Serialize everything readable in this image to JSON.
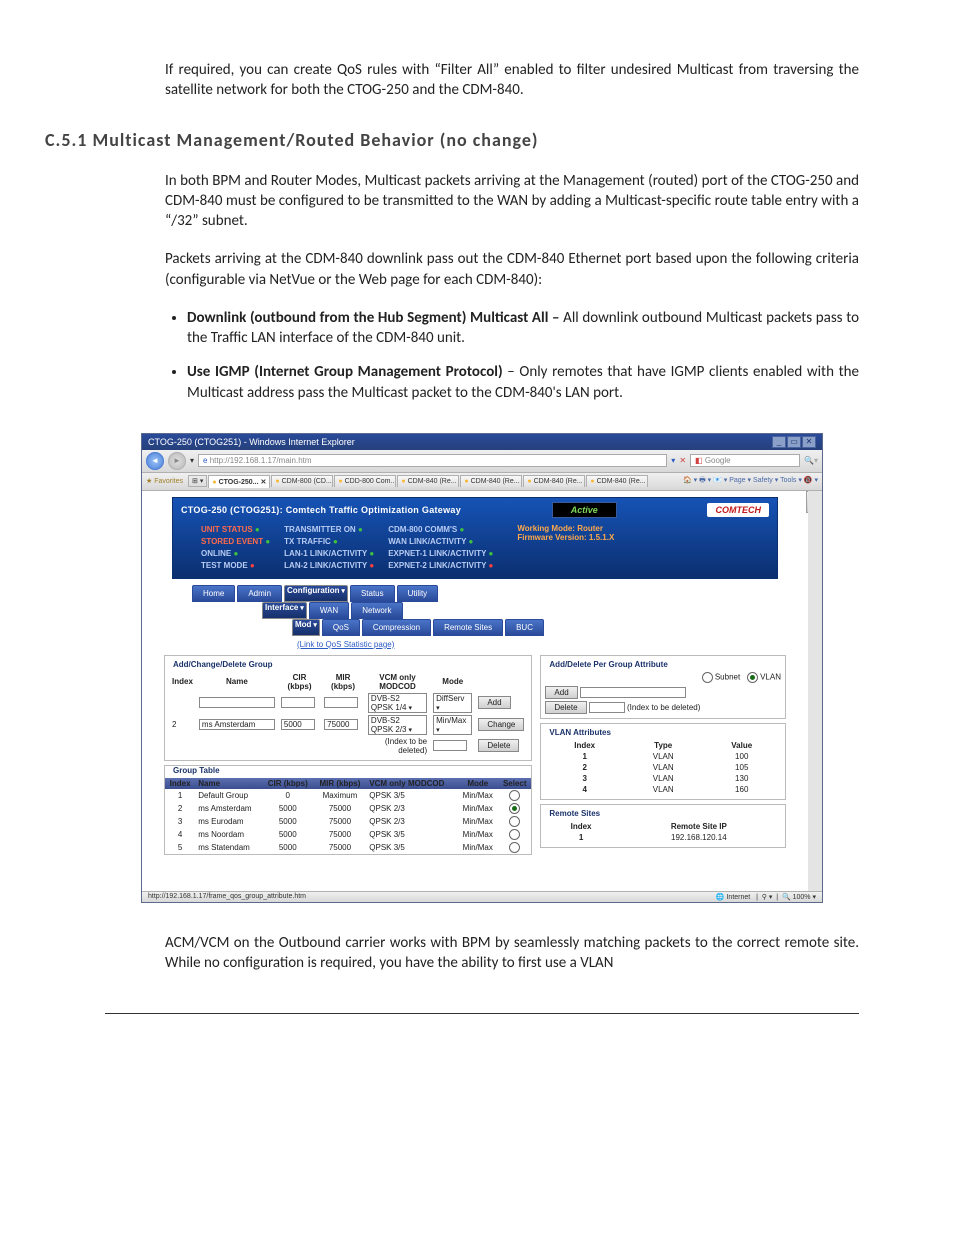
{
  "doc": {
    "intro_para": "If required, you can create QoS rules with “Filter All” enabled to filter undesired Multicast from traversing the satellite network for both the CTOG-250 and the CDM-840.",
    "heading": "C.5.1  Multicast Management/Routed Behavior (no change)",
    "para1": "In both BPM and Router Modes, Multicast packets arriving at the Management (routed) port of the CTOG-250 and CDM-840 must be configured to be transmitted to the WAN by adding a Multicast-specific route table entry with a “/32” subnet.",
    "para2": "Packets arriving at the CDM-840 downlink pass out the CDM-840 Ethernet port based upon the following criteria (configurable via NetVue or the Web page for each CDM-840):",
    "bullet1_lead": "Downlink (outbound from the Hub Segment) Multicast All – ",
    "bullet1_rest": "All downlink outbound Multicast packets pass to the Traffic LAN interface of the CDM-840 unit.",
    "bullet2_lead": "Use IGMP (Internet Group Management Protocol) ",
    "bullet2_rest": "– Only remotes that have IGMP clients enabled with the Multicast address pass the Multicast packet to the CDM-840's LAN port.",
    "closing": "ACM/VCM on the Outbound carrier works with BPM by seamlessly matching packets to the correct remote site. While no configuration is required, you have the ability to first use a VLAN"
  },
  "ie": {
    "title": "CTOG-250 (CTOG251) - Windows Internet Explorer",
    "url": "http://192.168.1.17/main.htm",
    "search_placeholder": "Google",
    "favorites": "Favorites",
    "tabs": [
      "CTOG-250... ✕",
      "CDM-800 (CD...",
      "CDD-800 Com...",
      "CDM-840 (Re...",
      "CDM-840 (Re...",
      "CDM-840 (Re...",
      "CDM-840 (Re..."
    ],
    "menu_right": "🏠 ▾  🖶  ▾  📧 ▾  Page ▾  Safety ▾  Tools ▾  🔞 ▾",
    "status_left": "http://192.168.1.17/frame_qos_group_attribute.htm",
    "status_right_internet": "Internet",
    "status_zoom": "100%"
  },
  "app": {
    "banner_title": "CTOG-250 (CTOG251): Comtech Traffic Optimization Gateway",
    "active": "Active",
    "logo": "COMTECH",
    "status": {
      "col1": [
        "UNIT STATUS",
        "STORED EVENT",
        "ONLINE",
        "TEST MODE"
      ],
      "col2": [
        "TRANSMITTER ON",
        "TX TRAFFIC",
        "LAN-1 LINK/ACTIVITY",
        "LAN-2 LINK/ACTIVITY"
      ],
      "col3": [
        "CDM-800 COMM'S",
        "WAN LINK/ACTIVITY",
        "EXPNET-1 LINK/ACTIVITY",
        "EXPNET-2 LINK/ACTIVITY"
      ],
      "mode": "Working Mode:  Router",
      "fw": "Firmware Version: 1.5.1.X"
    },
    "tabs_main": [
      "Home",
      "Admin",
      "Configuration",
      "Status",
      "Utility"
    ],
    "tabs_sub": [
      "Interface",
      "WAN",
      "Network"
    ],
    "tabs_sub2": [
      "Mod",
      "QoS",
      "Compression",
      "Remote Sites",
      "BUC"
    ],
    "qos_link": "(Link to QoS Statistic page)"
  },
  "forms": {
    "group_box_title": "Add/Change/Delete Group",
    "group_hdr": [
      "Index",
      "Name",
      "CIR (kbps)",
      "MIR (kbps)",
      "VCM only MODCOD",
      "Mode",
      ""
    ],
    "group_row1": [
      "",
      "",
      "",
      "",
      "DVB-S2 QPSK 1/4",
      "DiffServ",
      "Add"
    ],
    "group_row2": [
      "2",
      "ms Amsterdam",
      "5000",
      "75000",
      "DVB-S2 QPSK 2/3",
      "Min/Max",
      "Change"
    ],
    "group_row3_note": "(Index to be deleted)",
    "group_row3_btn": "Delete",
    "table_box_title": "Group Table",
    "table_hdr": [
      "Index",
      "Name",
      "CIR (kbps)",
      "MIR (kbps)",
      "VCM only MODCOD",
      "Mode",
      "Select"
    ],
    "table_rows": [
      [
        "1",
        "Default Group",
        "0",
        "Maximum",
        "QPSK 3/5",
        "Min/Max",
        "off"
      ],
      [
        "2",
        "ms Amsterdam",
        "5000",
        "75000",
        "QPSK 2/3",
        "Min/Max",
        "on"
      ],
      [
        "3",
        "ms Eurodam",
        "5000",
        "75000",
        "QPSK 2/3",
        "Min/Max",
        "off"
      ],
      [
        "4",
        "ms Noordam",
        "5000",
        "75000",
        "QPSK 3/5",
        "Min/Max",
        "off"
      ],
      [
        "5",
        "ms Statendam",
        "5000",
        "75000",
        "QPSK 3/5",
        "Min/Max",
        "off"
      ]
    ],
    "attr_title": "Add/Delete Per Group Attribute",
    "attr_opt_subnet": "Subnet",
    "attr_opt_vlan": "VLAN",
    "attr_add": "Add",
    "attr_del": "Delete",
    "attr_del_note": "(Index to be deleted)",
    "vlan_title": "VLAN Attributes",
    "vlan_hdr": [
      "Index",
      "Type",
      "Value"
    ],
    "vlan_rows": [
      [
        "1",
        "VLAN",
        "100"
      ],
      [
        "2",
        "VLAN",
        "105"
      ],
      [
        "3",
        "VLAN",
        "130"
      ],
      [
        "4",
        "VLAN",
        "160"
      ]
    ],
    "remote_title": "Remote Sites",
    "remote_hdr": [
      "Index",
      "Remote Site IP"
    ],
    "remote_rows": [
      [
        "1",
        "192.168.120.14"
      ]
    ]
  }
}
